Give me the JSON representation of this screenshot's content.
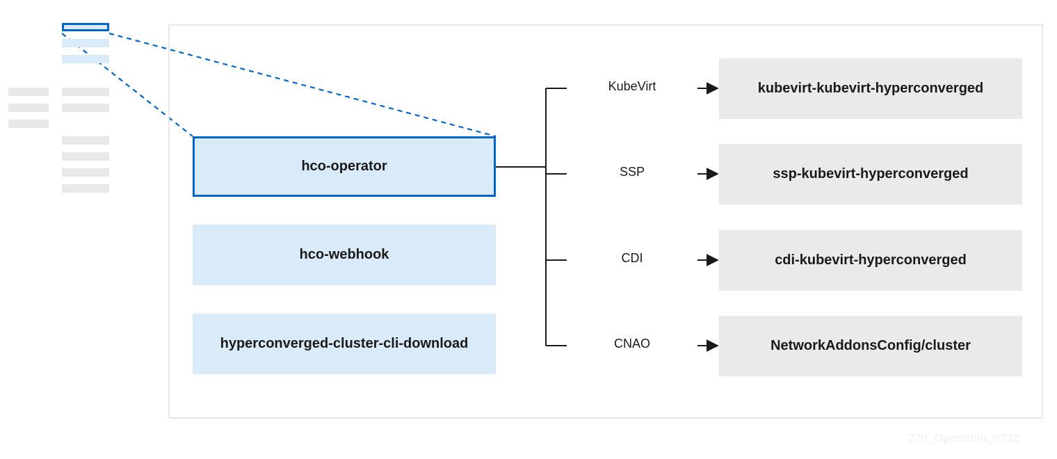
{
  "operators": {
    "hco_operator": "hco-operator",
    "hco_webhook": "hco-webhook",
    "hcc_cli_download": "hyperconverged-cluster-cli-download"
  },
  "edges": {
    "kubevirt": "KubeVirt",
    "ssp": "SSP",
    "cdi": "CDI",
    "cnao": "CNAO"
  },
  "targets": {
    "kubevirt": "kubevirt-kubevirt-hyperconverged",
    "ssp": "ssp-kubevirt-hyperconverged",
    "cdi": "cdi-kubevirt-hyperconverged",
    "cnao": "NetworkAddonsConfig/cluster"
  },
  "watermark": "220_OpenShift_0722"
}
